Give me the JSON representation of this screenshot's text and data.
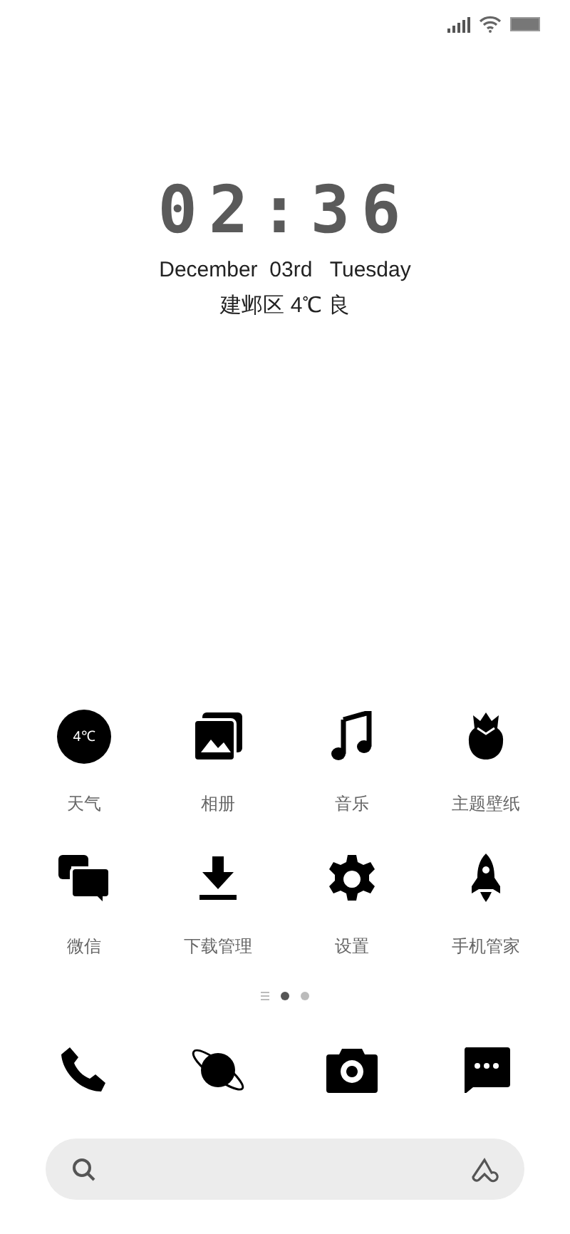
{
  "clock": {
    "time": "02:36",
    "date": "December  03rd   Tuesday",
    "weather": "建邺区 4℃ 良"
  },
  "apps": [
    {
      "label": "天气",
      "badge": "4℃"
    },
    {
      "label": "相册"
    },
    {
      "label": "音乐"
    },
    {
      "label": "主题壁纸"
    },
    {
      "label": "微信"
    },
    {
      "label": "下载管理"
    },
    {
      "label": "设置"
    },
    {
      "label": "手机管家"
    }
  ],
  "pages": [
    {
      "kind": "list",
      "selected": false
    },
    {
      "kind": "dot",
      "selected": true
    },
    {
      "kind": "dot",
      "selected": false
    }
  ],
  "dock": [
    {
      "kind": "phone"
    },
    {
      "kind": "planet"
    },
    {
      "kind": "camera"
    },
    {
      "kind": "message"
    }
  ]
}
